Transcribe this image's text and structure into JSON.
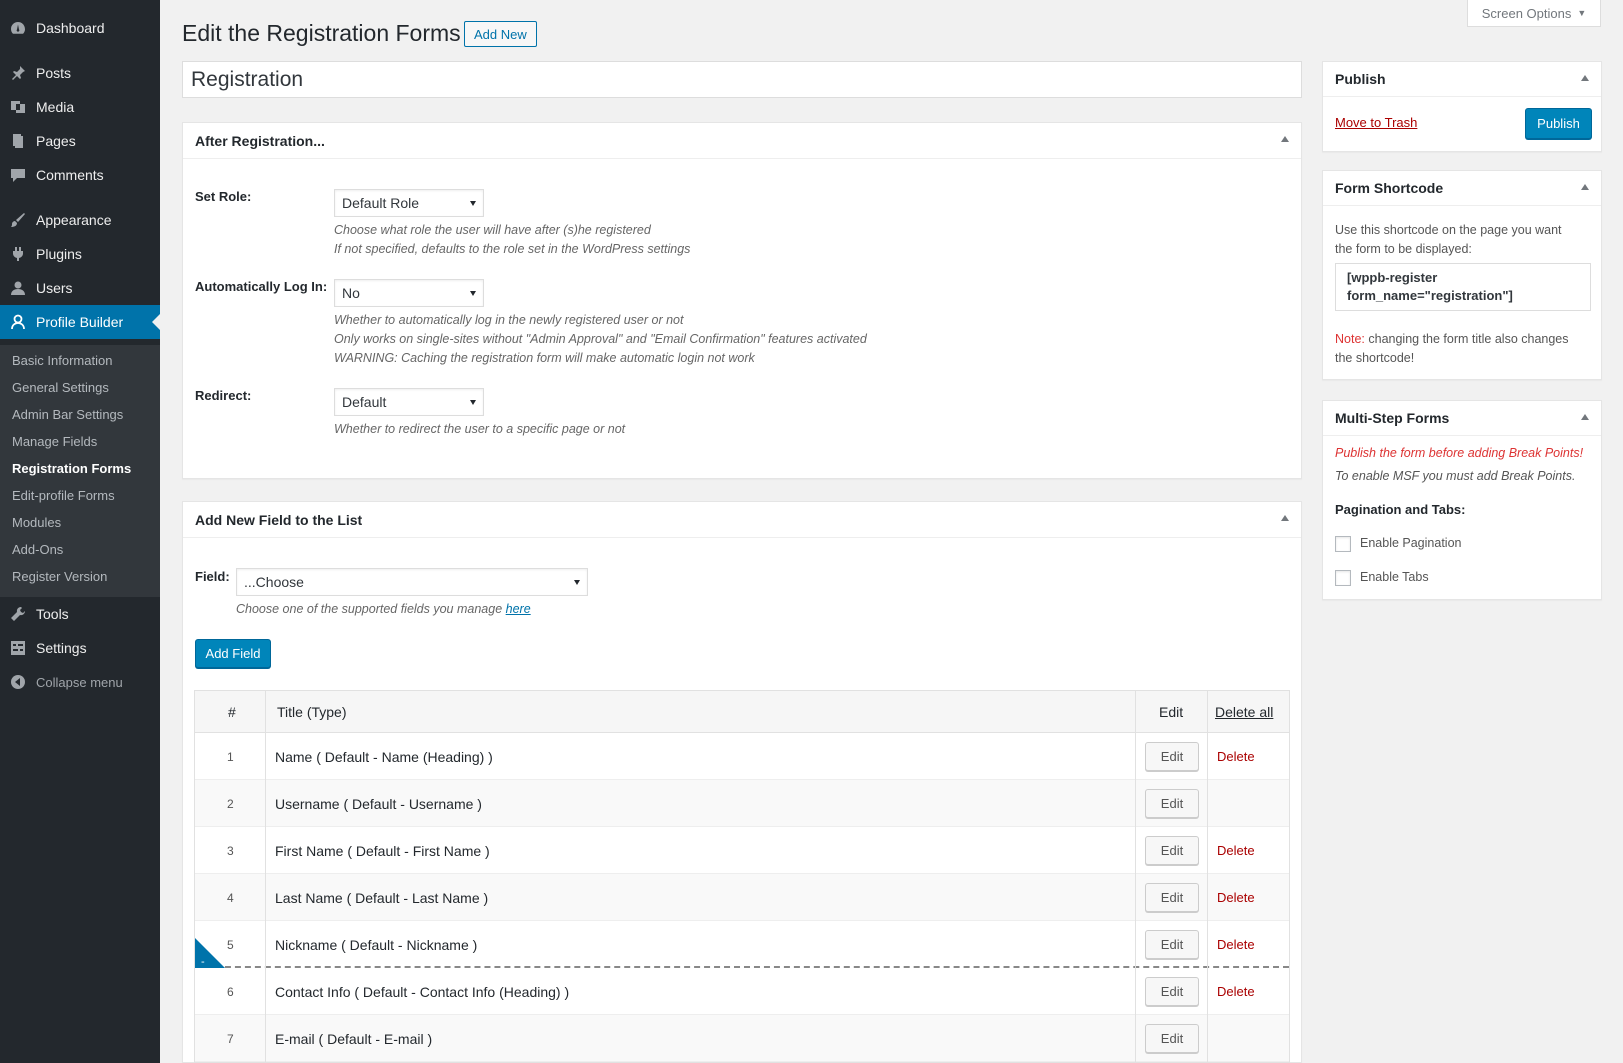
{
  "admin_menu": {
    "items": [
      {
        "label": "Dashboard",
        "icon": "dashboard-icon"
      },
      {
        "label": "Posts",
        "icon": "pin-icon"
      },
      {
        "label": "Media",
        "icon": "media-icon"
      },
      {
        "label": "Pages",
        "icon": "pages-icon"
      },
      {
        "label": "Comments",
        "icon": "comment-icon"
      },
      {
        "label": "Appearance",
        "icon": "brush-icon"
      },
      {
        "label": "Plugins",
        "icon": "plugin-icon"
      },
      {
        "label": "Users",
        "icon": "users-icon"
      },
      {
        "label": "Profile Builder",
        "icon": "profile-icon"
      }
    ],
    "submenu": [
      "Basic Information",
      "General Settings",
      "Admin Bar Settings",
      "Manage Fields",
      "Registration Forms",
      "Edit-profile Forms",
      "Modules",
      "Add-Ons",
      "Register Version"
    ],
    "after_items": [
      {
        "label": "Tools",
        "icon": "wrench-icon"
      },
      {
        "label": "Settings",
        "icon": "settings-icon"
      }
    ],
    "collapse_label": "Collapse menu"
  },
  "header": {
    "title": "Edit the Registration Forms",
    "add_new": "Add New",
    "screen_options": "Screen Options"
  },
  "form_title": "Registration",
  "after_registration": {
    "title": "After Registration...",
    "set_role": {
      "label": "Set Role:",
      "value": "Default Role",
      "desc1": "Choose what role the user will have after (s)he registered",
      "desc2": "If not specified, defaults to the role set in the WordPress settings"
    },
    "auto_login": {
      "label": "Automatically Log In:",
      "value": "No",
      "desc1": "Whether to automatically log in the newly registered user or not",
      "desc2": "Only works on single-sites without \"Admin Approval\" and \"Email Confirmation\" features activated",
      "desc3": "WARNING: Caching the registration form will make automatic login not work"
    },
    "redirect": {
      "label": "Redirect:",
      "value": "Default",
      "desc": "Whether to redirect the user to a specific page or not"
    }
  },
  "add_field": {
    "title": "Add New Field to the List",
    "label": "Field:",
    "value": "...Choose",
    "desc": "Choose one of the supported fields you manage",
    "desc_link": "here",
    "button": "Add Field"
  },
  "table": {
    "headers": {
      "num": "#",
      "title": "Title (Type)",
      "edit": "Edit",
      "delete_all": "Delete all"
    },
    "edit_label": "Edit",
    "delete_label": "Delete",
    "rows": [
      {
        "num": "1",
        "title": "Name ( Default - Name (Heading) )",
        "delete": "Delete"
      },
      {
        "num": "2",
        "title": "Username ( Default - Username )",
        "delete": ""
      },
      {
        "num": "3",
        "title": "First Name ( Default - First Name )",
        "delete": "Delete"
      },
      {
        "num": "4",
        "title": "Last Name ( Default - Last Name )",
        "delete": "Delete"
      },
      {
        "num": "5",
        "title": "Nickname ( Default - Nickname )",
        "delete": "Delete"
      },
      {
        "num": "6",
        "title": "Contact Info ( Default - Contact Info (Heading) )",
        "delete": "Delete"
      },
      {
        "num": "7",
        "title": "E-mail ( Default - E-mail )",
        "delete": ""
      }
    ]
  },
  "publish_box": {
    "title": "Publish",
    "trash": "Move to Trash",
    "button": "Publish"
  },
  "shortcode_box": {
    "title": "Form Shortcode",
    "desc1": "Use this shortcode on the page you want",
    "desc2": "the form to be displayed:",
    "code1": "[wppb-register",
    "code2": "form_name=\"registration\"]",
    "note_label": "Note:",
    "note1": "changing the form title also changes",
    "note2": "the shortcode!"
  },
  "msf_box": {
    "title": "Multi-Step Forms",
    "warning": "Publish the form before adding Break Points!",
    "info": "To enable MSF you must add Break Points.",
    "section": "Pagination and Tabs:",
    "opt1": "Enable Pagination",
    "opt2": "Enable Tabs"
  },
  "colors": {
    "accent": "#0073aa",
    "primary_button": "#0085ba",
    "menu_bg": "#23282d",
    "danger": "#a00"
  }
}
